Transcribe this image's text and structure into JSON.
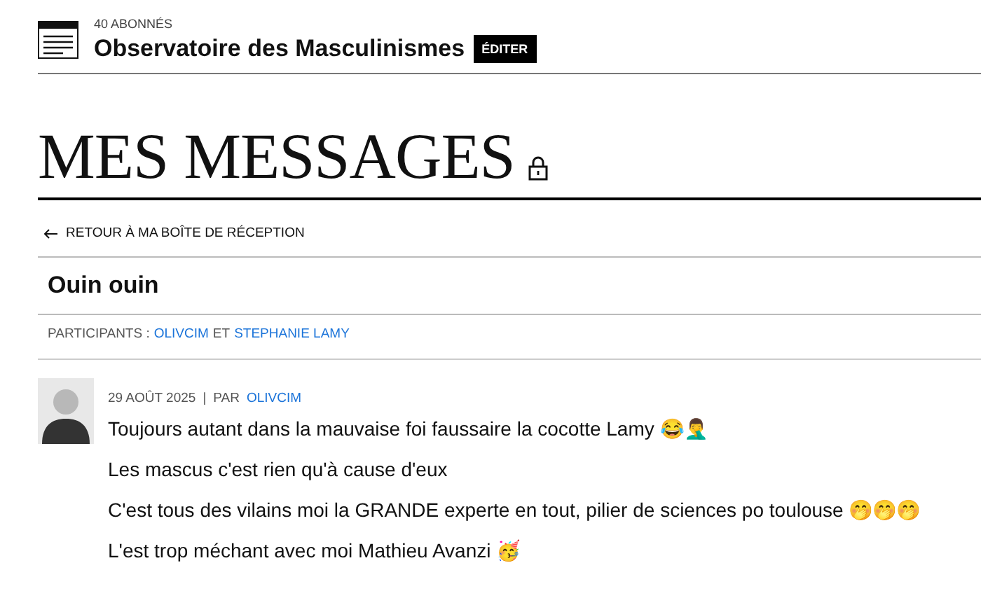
{
  "blog": {
    "subscribers": "40 ABONNÉS",
    "name": "Observatoire des Masculinismes",
    "edit_button": "ÉDITER"
  },
  "page_title": "MES MESSAGES",
  "back_link": "RETOUR À MA BOÎTE DE RÉCEPTION",
  "conversation": {
    "subject": "Ouin ouin",
    "participants_label": "PARTICIPANTS :",
    "participants": [
      "OLIVCIM",
      "STEPHANIE LAMY"
    ],
    "participants_joiner": "ET"
  },
  "messages": [
    {
      "date": "29 AOÛT 2025",
      "separator": "|",
      "by_label": "PAR",
      "author": "OLIVCIM",
      "paragraphs": [
        "Toujours autant dans la mauvaise foi faussaire la cocotte Lamy 😂🤦‍♂️",
        "Les mascus c'est rien qu'à cause d'eux",
        "C'est tous des vilains moi la GRANDE experte en tout, pilier de sciences po toulouse 🤭🤭🤭",
        "L'est trop méchant avec moi Mathieu Avanzi 🥳"
      ]
    }
  ]
}
